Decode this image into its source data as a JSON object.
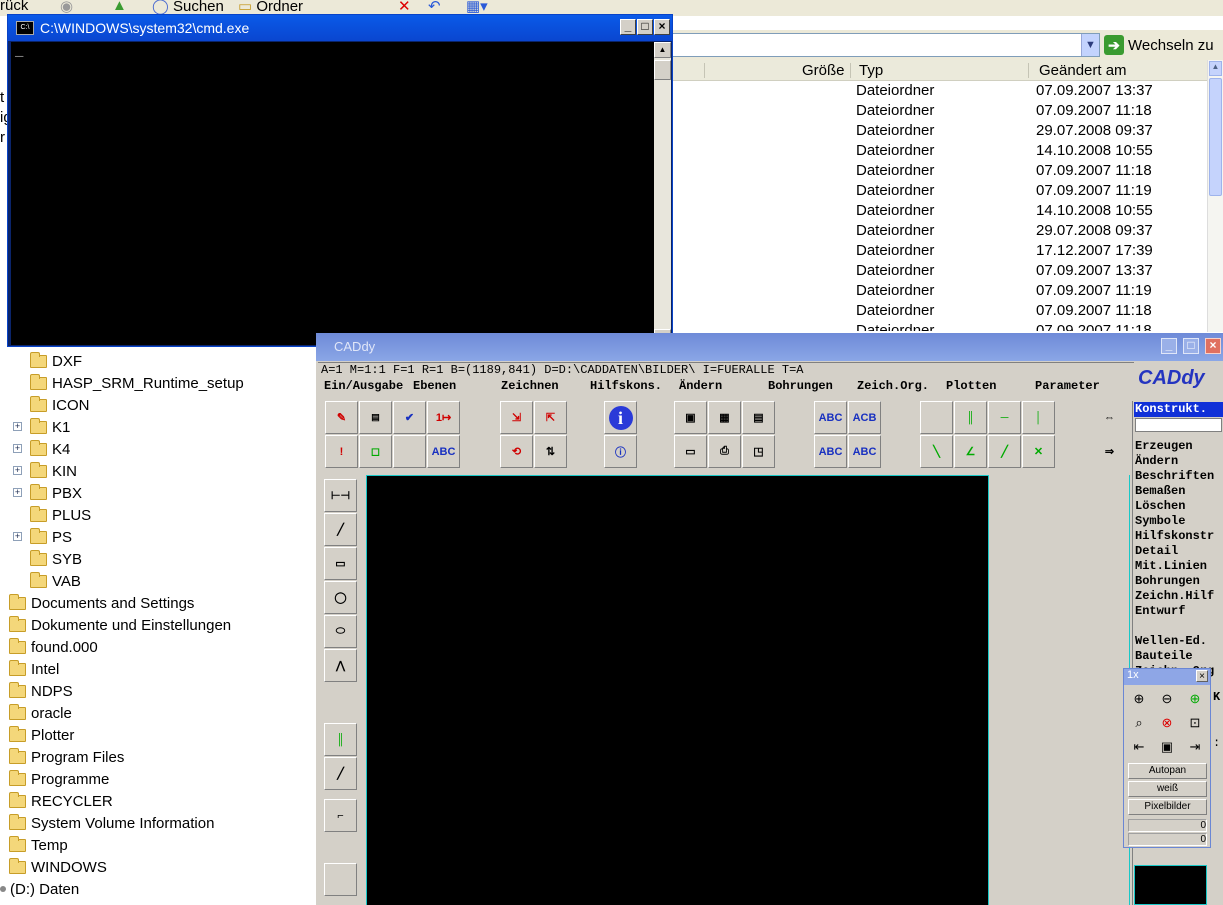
{
  "explorer": {
    "toolbar": {
      "back_label": "rück",
      "search_label": "Suchen",
      "folders_label": "Ordner"
    },
    "address": {
      "go_label": "Wechseln zu"
    },
    "columns": {
      "size": "Größe",
      "type": "Typ",
      "modified": "Geändert am"
    },
    "rows": [
      {
        "type": "Dateiordner",
        "modified": "07.09.2007 13:37"
      },
      {
        "type": "Dateiordner",
        "modified": "07.09.2007 11:18"
      },
      {
        "type": "Dateiordner",
        "modified": "29.07.2008 09:37"
      },
      {
        "type": "Dateiordner",
        "modified": "14.10.2008 10:55"
      },
      {
        "type": "Dateiordner",
        "modified": "07.09.2007 11:18"
      },
      {
        "type": "Dateiordner",
        "modified": "07.09.2007 11:19"
      },
      {
        "type": "Dateiordner",
        "modified": "14.10.2008 10:55"
      },
      {
        "type": "Dateiordner",
        "modified": "29.07.2008 09:37"
      },
      {
        "type": "Dateiordner",
        "modified": "17.12.2007 17:39"
      },
      {
        "type": "Dateiordner",
        "modified": "07.09.2007 13:37"
      },
      {
        "type": "Dateiordner",
        "modified": "07.09.2007 11:19"
      },
      {
        "type": "Dateiordner",
        "modified": "07.09.2007 11:18"
      },
      {
        "type": "Dateiordner",
        "modified": "07.09.2007 11:18"
      }
    ],
    "left_edge_letters": [
      "t",
      "ig",
      "r"
    ],
    "tree": [
      {
        "label": "DXF",
        "expandable": false,
        "level": 2
      },
      {
        "label": "HASP_SRM_Runtime_setup",
        "expandable": false,
        "level": 2
      },
      {
        "label": "ICON",
        "expandable": false,
        "level": 2
      },
      {
        "label": "K1",
        "expandable": true,
        "level": 2
      },
      {
        "label": "K4",
        "expandable": true,
        "level": 2
      },
      {
        "label": "KIN",
        "expandable": true,
        "level": 2
      },
      {
        "label": "PBX",
        "expandable": true,
        "level": 2
      },
      {
        "label": "PLUS",
        "expandable": false,
        "level": 2
      },
      {
        "label": "PS",
        "expandable": true,
        "level": 2
      },
      {
        "label": "SYB",
        "expandable": false,
        "level": 2
      },
      {
        "label": "VAB",
        "expandable": false,
        "level": 2
      },
      {
        "label": "Documents and Settings",
        "expandable": false,
        "level": 1
      },
      {
        "label": "Dokumente und Einstellungen",
        "expandable": false,
        "level": 1
      },
      {
        "label": "found.000",
        "expandable": false,
        "level": 1
      },
      {
        "label": "Intel",
        "expandable": false,
        "level": 1
      },
      {
        "label": "NDPS",
        "expandable": false,
        "level": 1
      },
      {
        "label": "oracle",
        "expandable": false,
        "level": 1
      },
      {
        "label": "Plotter",
        "expandable": false,
        "level": 1
      },
      {
        "label": "Program Files",
        "expandable": false,
        "level": 1
      },
      {
        "label": "Programme",
        "expandable": false,
        "level": 1
      },
      {
        "label": "RECYCLER",
        "expandable": false,
        "level": 1
      },
      {
        "label": "System Volume Information",
        "expandable": false,
        "level": 1
      },
      {
        "label": "Temp",
        "expandable": false,
        "level": 1
      },
      {
        "label": "WINDOWS",
        "expandable": false,
        "level": 1
      },
      {
        "label": "(D:) Daten",
        "expandable": false,
        "level": 0
      }
    ]
  },
  "cmd": {
    "title": "C:\\WINDOWS\\system32\\cmd.exe",
    "icon_text": "C:\\",
    "cursor": "_",
    "min": "_",
    "max": "□",
    "close": "×"
  },
  "cad": {
    "title": "CADdy",
    "status_line": "A=1  M=1:1  F=1  R=1  B=(1189,841)  D=D:\\CADDATEN\\BILDER\\  I=FUERALLE  T=A",
    "menu": [
      "Ein/Ausgabe",
      "Ebenen",
      "Zeichnen",
      "Hilfskons.",
      "Ändern",
      "Bohrungen",
      "Zeich.Org.",
      "Plotten",
      "Parameter"
    ],
    "logo": "CADdy",
    "icon_labels": {
      "abc": "ABC",
      "acb": "ACB",
      "abc_sy": "ABC",
      "one": "1"
    },
    "side_menu": [
      "Konstrukt.",
      "Erzeugen",
      "Ändern",
      "Beschriften",
      "Bemaßen",
      "Löschen",
      "Symbole",
      "Hilfskonstr",
      "Detail",
      "Mit.Linien",
      "Bohrungen",
      "Zeichn.Hilf",
      "Entwurf",
      "Wellen-Ed.",
      "Bauteile",
      "Zeichn.-Org"
    ],
    "side_extra": [
      "K",
      ":"
    ],
    "zoom_box": {
      "title": "1x",
      "close": "×",
      "buttons": [
        "Autopan",
        "weiß",
        "Pixelbilder"
      ],
      "values": [
        "0",
        "0"
      ]
    },
    "colors": {
      "canvas": "#000000",
      "grid_border": "#18c8c8",
      "menu_selected": "#1030d8"
    }
  }
}
